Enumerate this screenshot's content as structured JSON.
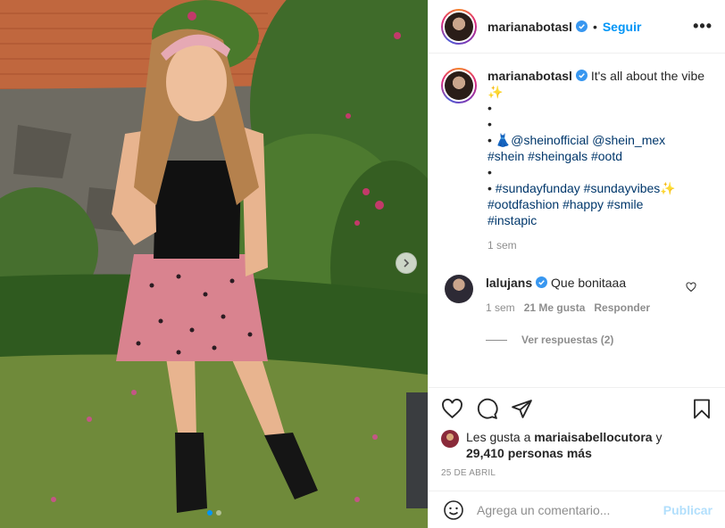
{
  "post": {
    "username": "marianabotasl",
    "follow_label": "Seguir",
    "separator": "•",
    "more_label": "•••"
  },
  "caption": {
    "username": "marianabotasl",
    "text_first": "It's all about the vibe ✨",
    "bullets": [
      "•",
      "•"
    ],
    "line3_bullet": "•",
    "line3_emoji": "👗",
    "line3_tags": [
      "@sheinofficial",
      "@shein_mex"
    ],
    "line4_tags": [
      "#shein",
      "#sheingals",
      "#ootd"
    ],
    "bullet5": "•",
    "line6_bullet": "•",
    "line6_tags": [
      "#sundayfunday",
      "#sundayvibes"
    ],
    "line6_emoji": "✨",
    "line7_tags": [
      "#ootdfashion",
      "#happy",
      "#smile"
    ],
    "line8_tags": [
      "#instapic"
    ],
    "time": "1 sem"
  },
  "comment": {
    "username": "lalujans",
    "text": "Que bonitaaa",
    "time": "1 sem",
    "likes": "21 Me gusta",
    "reply_label": "Responder",
    "view_replies": "Ver respuestas (2)"
  },
  "likes": {
    "prefix": "Les gusta a ",
    "user": "mariaisabellocutora",
    "conj": " y",
    "count": "29,410 personas más"
  },
  "date": "25 DE ABRIL",
  "composer": {
    "placeholder": "Agrega un comentario...",
    "publish_label": "Publicar"
  },
  "colors": {
    "accent": "#0095f6",
    "link": "#00376b",
    "muted": "#8e8e8e",
    "publish_disabled": "#b2dffc"
  },
  "icons": [
    "verified-badge-icon",
    "more-options-icon",
    "heart-icon",
    "comment-icon",
    "share-icon",
    "bookmark-icon",
    "emoji-icon",
    "chevron-right-icon"
  ],
  "carousel": {
    "slides": 2,
    "active": 1
  }
}
